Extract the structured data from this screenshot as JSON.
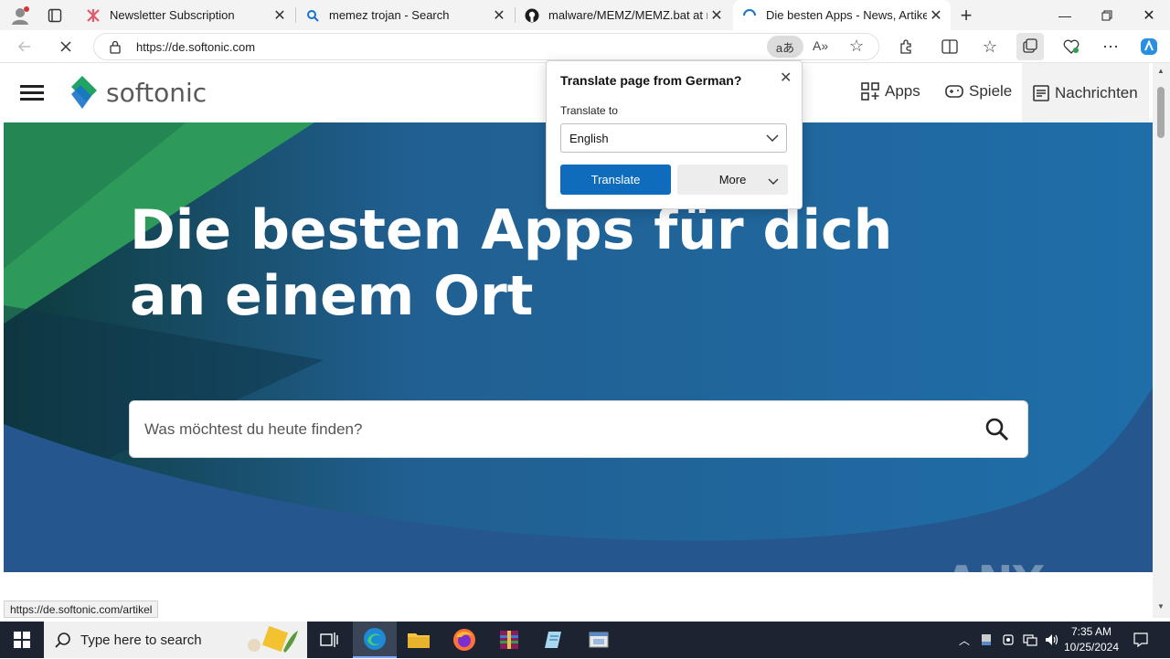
{
  "browser": {
    "tabs": [
      {
        "title": "Newsletter Subscription",
        "active": false
      },
      {
        "title": "memez trojan - Search",
        "active": false
      },
      {
        "title": "malware/MEMZ/MEMZ.bat at m",
        "active": false
      },
      {
        "title": "Die besten Apps - News, Artikel,",
        "active": true
      }
    ],
    "url": "https://de.softonic.com",
    "status_url": "https://de.softonic.com/artikel"
  },
  "site": {
    "logo_text": "softonic",
    "nav": {
      "apps": "Apps",
      "games": "Spiele",
      "news": "Nachrichten"
    },
    "hero_title": "Die besten Apps für dich an einem Ort",
    "search_placeholder": "Was möchtest du heute finden?"
  },
  "translate_popup": {
    "title": "Translate page from  German?",
    "translate_to_label": "Translate to",
    "language": "English",
    "translate_button": "Translate",
    "more_button": "More"
  },
  "taskbar": {
    "search_placeholder": "Type here to search",
    "time": "7:35 AM",
    "date": "10/25/2024"
  },
  "watermark": "ANY RUN",
  "colors": {
    "accent": "#0f6cbd",
    "hero": "#2a6f9f",
    "logo_green": "#1fa463",
    "taskbar": "#1c2331"
  }
}
